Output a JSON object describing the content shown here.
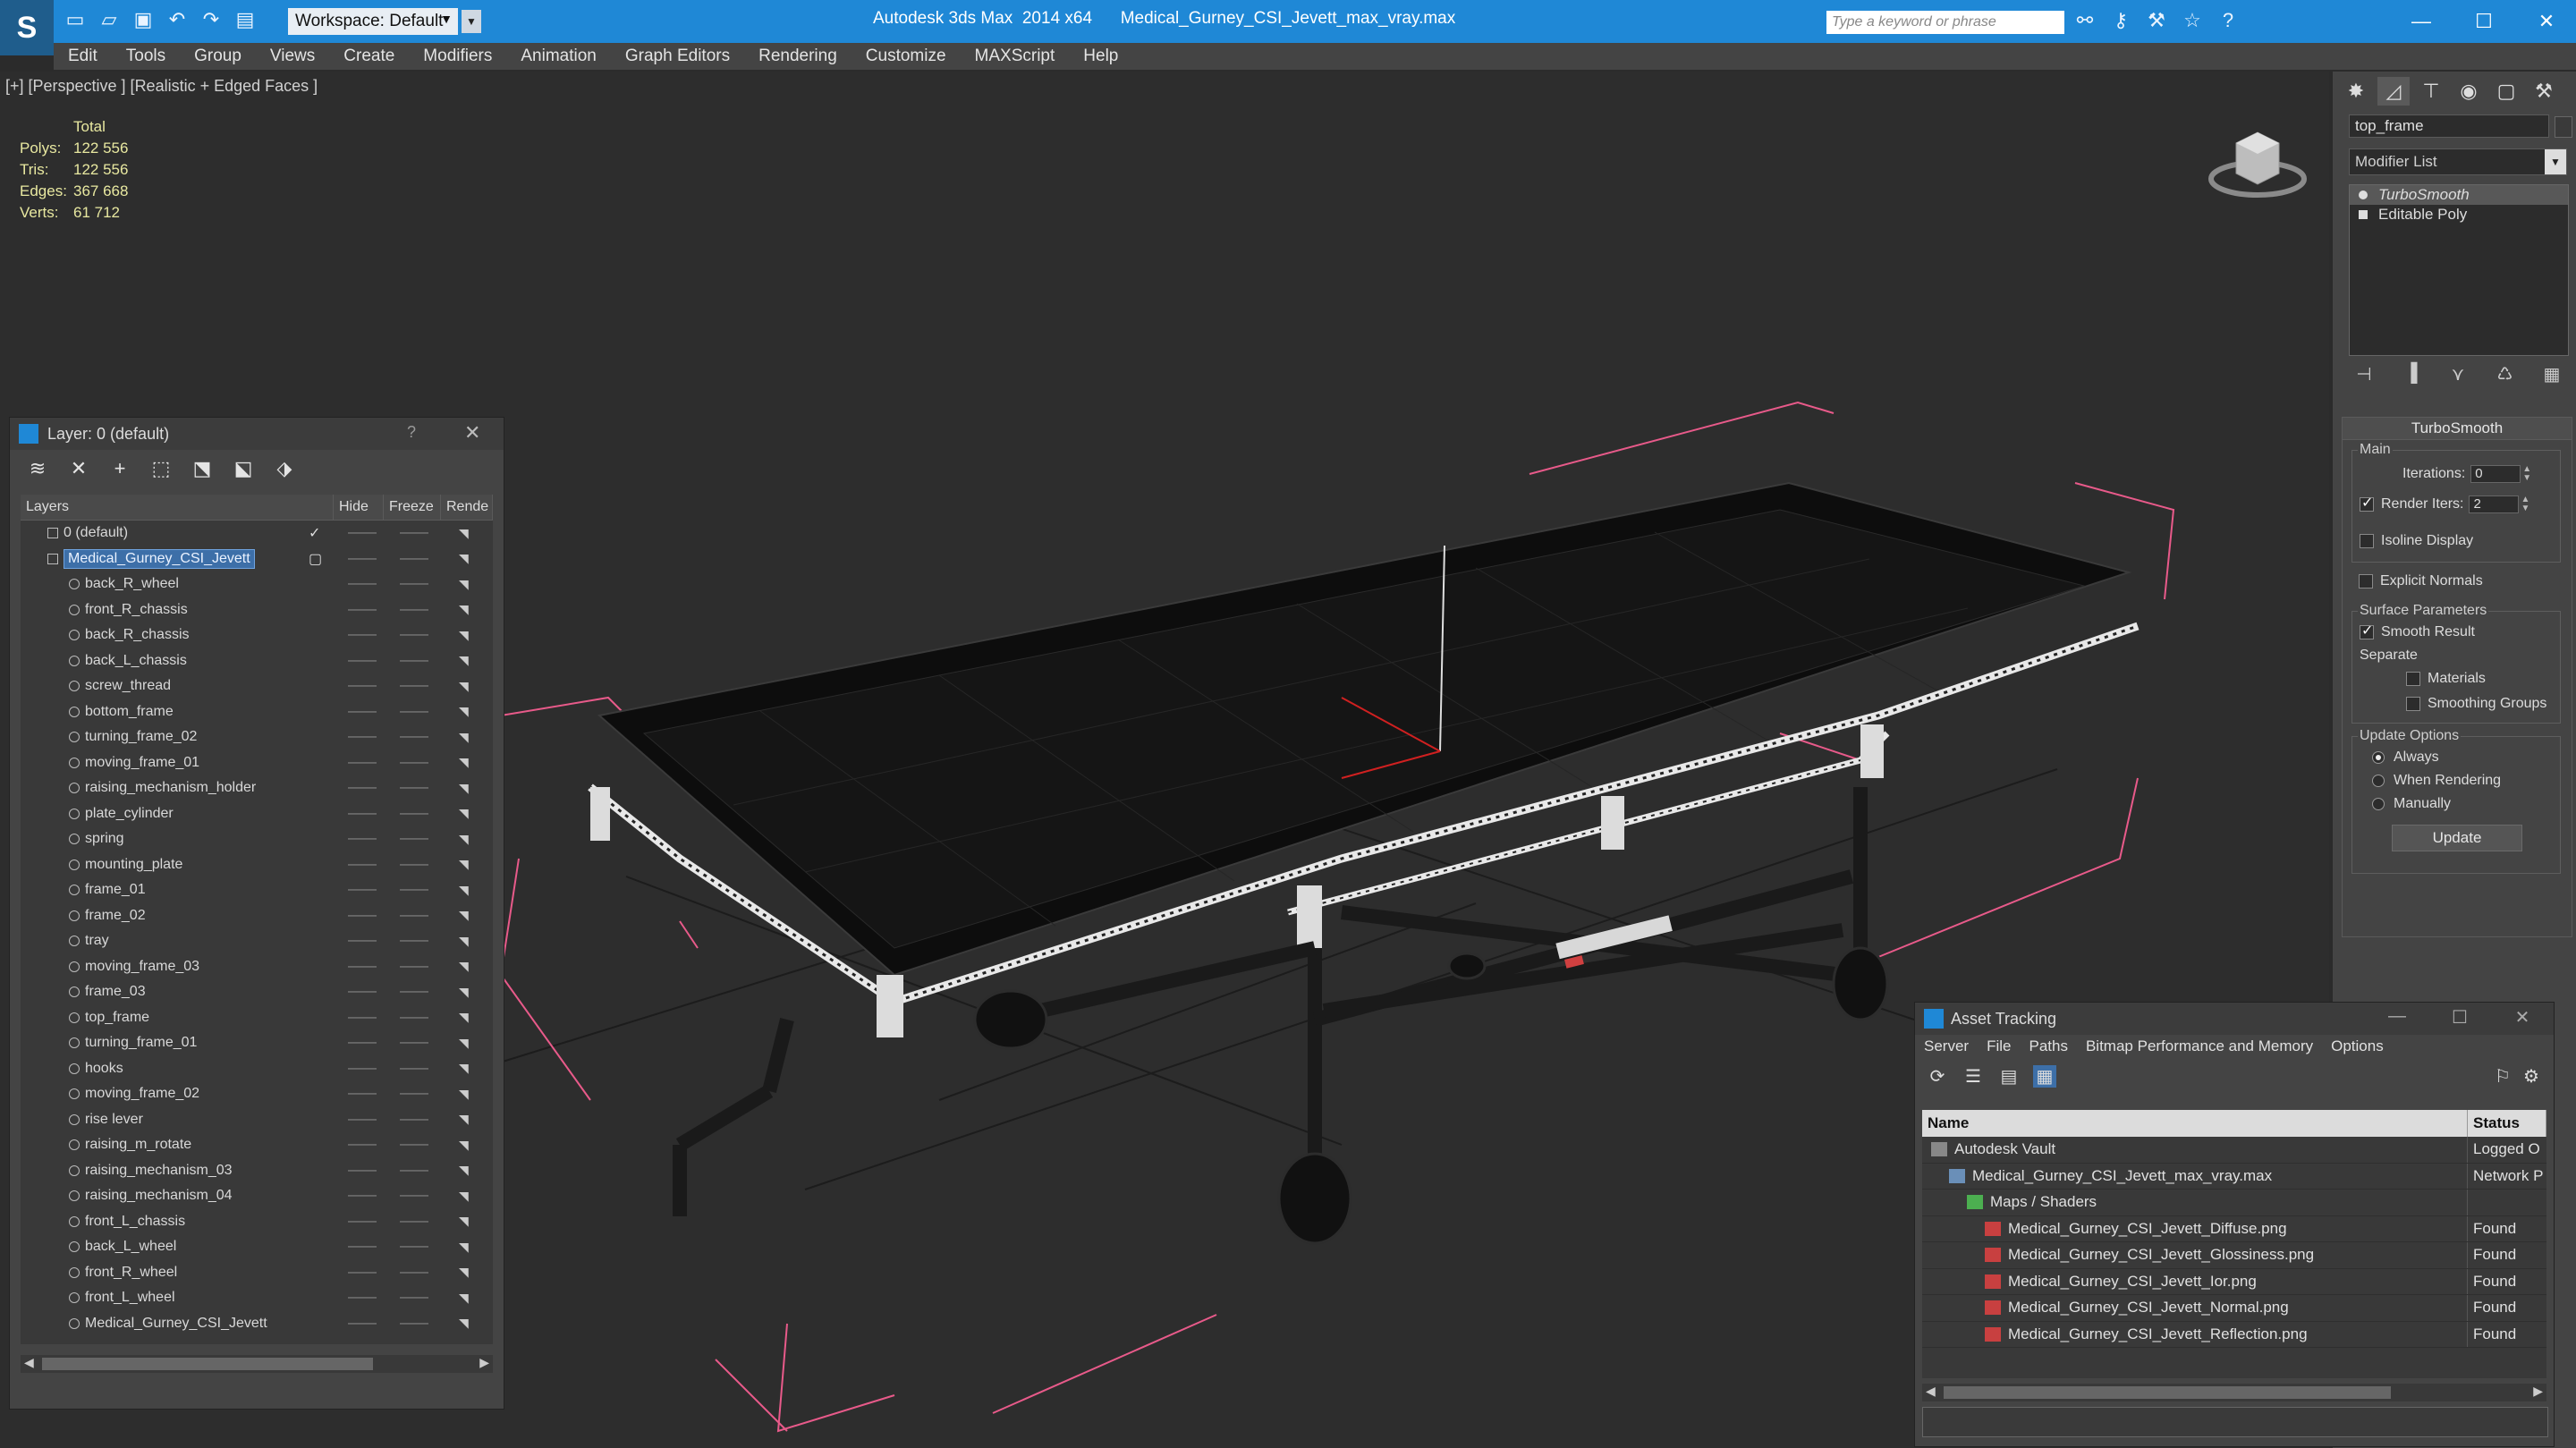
{
  "title_bar": {
    "app_title": "Autodesk 3ds Max  2014 x64      Medical_Gurney_CSI_Jevett_max_vray.max",
    "workspace_label": "Workspace: Default",
    "search_placeholder": "Type a keyword or phrase"
  },
  "menu": [
    "Edit",
    "Tools",
    "Group",
    "Views",
    "Create",
    "Modifiers",
    "Animation",
    "Graph Editors",
    "Rendering",
    "Customize",
    "MAXScript",
    "Help"
  ],
  "viewport": {
    "label": "[+] [Perspective ] [Realistic + Edged Faces ]",
    "stats": {
      "header": "Total",
      "rows": [
        {
          "k": "Polys:",
          "v": "122 556"
        },
        {
          "k": "Tris:",
          "v": "122 556"
        },
        {
          "k": "Edges:",
          "v": "367 668"
        },
        {
          "k": "Verts:",
          "v": "61 712"
        }
      ]
    }
  },
  "command_panel": {
    "object_name": "top_frame",
    "modifier_list": "Modifier List",
    "stack": [
      "TurboSmooth",
      "Editable Poly"
    ],
    "rollout_title": "TurboSmooth",
    "main_group": "Main",
    "iterations_label": "Iterations:",
    "iterations_value": "0",
    "render_iters_label": "Render Iters:",
    "render_iters_value": "2",
    "isoline": "Isoline Display",
    "explicit_normals": "Explicit Normals",
    "surface_group": "Surface Parameters",
    "smooth_result": "Smooth Result",
    "separate": "Separate",
    "materials": "Materials",
    "smoothing_groups": "Smoothing Groups",
    "update_group": "Update Options",
    "always": "Always",
    "when_rendering": "When Rendering",
    "manually": "Manually",
    "update_button": "Update"
  },
  "layer_panel": {
    "title": "Layer: 0 (default)",
    "help": "?",
    "columns": [
      "Layers",
      "Hide",
      "Freeze",
      "Rende"
    ],
    "default_layer": "0 (default)",
    "selected_layer": "Medical_Gurney_CSI_Jevett",
    "objects": [
      "back_R_wheel",
      "front_R_chassis",
      "back_R_chassis",
      "back_L_chassis",
      "screw_thread",
      "bottom_frame",
      "turning_frame_02",
      "moving_frame_01",
      "raising_mechanism_holder",
      "plate_cylinder",
      "spring",
      "mounting_plate",
      "frame_01",
      "frame_02",
      "tray",
      "moving_frame_03",
      "frame_03",
      "top_frame",
      "turning_frame_01",
      "hooks",
      "moving_frame_02",
      "rise lever",
      "raising_m_rotate",
      "raising_mechanism_03",
      "raising_mechanism_04",
      "front_L_chassis",
      "back_L_wheel",
      "front_R_wheel",
      "front_L_wheel",
      "Medical_Gurney_CSI_Jevett"
    ]
  },
  "asset_tracking": {
    "title": "Asset Tracking",
    "menu": [
      "Server",
      "File",
      "Paths",
      "Bitmap Performance and Memory",
      "Options"
    ],
    "columns": [
      "Name",
      "Status"
    ],
    "rows": [
      {
        "name": "Autodesk Vault",
        "status": "Logged O",
        "indent": 1
      },
      {
        "name": "Medical_Gurney_CSI_Jevett_max_vray.max",
        "status": "Network P",
        "indent": 2
      },
      {
        "name": "Maps / Shaders",
        "status": "",
        "indent": 3
      },
      {
        "name": "Medical_Gurney_CSI_Jevett_Diffuse.png",
        "status": "Found",
        "indent": 4
      },
      {
        "name": "Medical_Gurney_CSI_Jevett_Glossiness.png",
        "status": "Found",
        "indent": 4
      },
      {
        "name": "Medical_Gurney_CSI_Jevett_Ior.png",
        "status": "Found",
        "indent": 4
      },
      {
        "name": "Medical_Gurney_CSI_Jevett_Normal.png",
        "status": "Found",
        "indent": 4
      },
      {
        "name": "Medical_Gurney_CSI_Jevett_Reflection.png",
        "status": "Found",
        "indent": 4
      }
    ]
  },
  "colors": {
    "title_blue": "#1f88d6",
    "selection_blue": "#3d6fa8",
    "stat_yellow": "#e8e8a0",
    "bbox_pink": "#e85a8a"
  }
}
